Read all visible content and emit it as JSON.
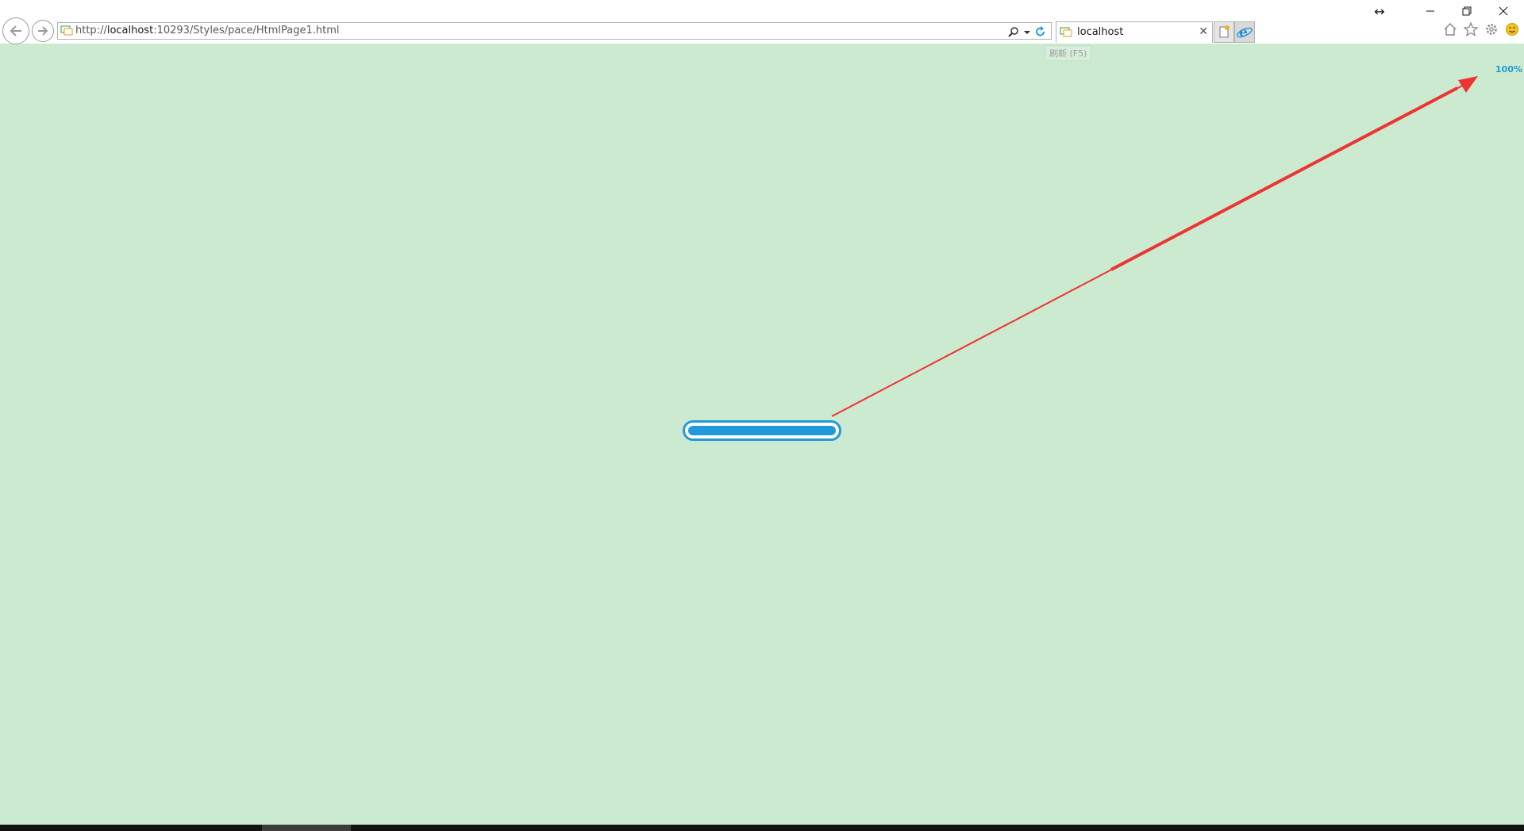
{
  "address_bar": {
    "url_prefix": "http://",
    "url_host": "localhost",
    "url_rest": ":10293/Styles/pace/HtmlPage1.html"
  },
  "tabs": [
    {
      "label": "localhost"
    }
  ],
  "tooltip": {
    "text": "刷新 (F5)"
  },
  "progress": {
    "percent_label": "100%",
    "value": 1.0
  },
  "colors": {
    "page_background": "#cbead0",
    "accent": "#2299dd",
    "arrow": "#ee3333"
  },
  "icons": [
    "back-icon",
    "forward-icon",
    "page-icon",
    "search-icon",
    "dropdown-icon",
    "refresh-icon",
    "close-icon",
    "new-tab-icon",
    "ie-icon",
    "home-icon",
    "favorites-icon",
    "settings-icon",
    "smiley-icon",
    "minimize-icon",
    "restore-icon",
    "resize-icon"
  ]
}
